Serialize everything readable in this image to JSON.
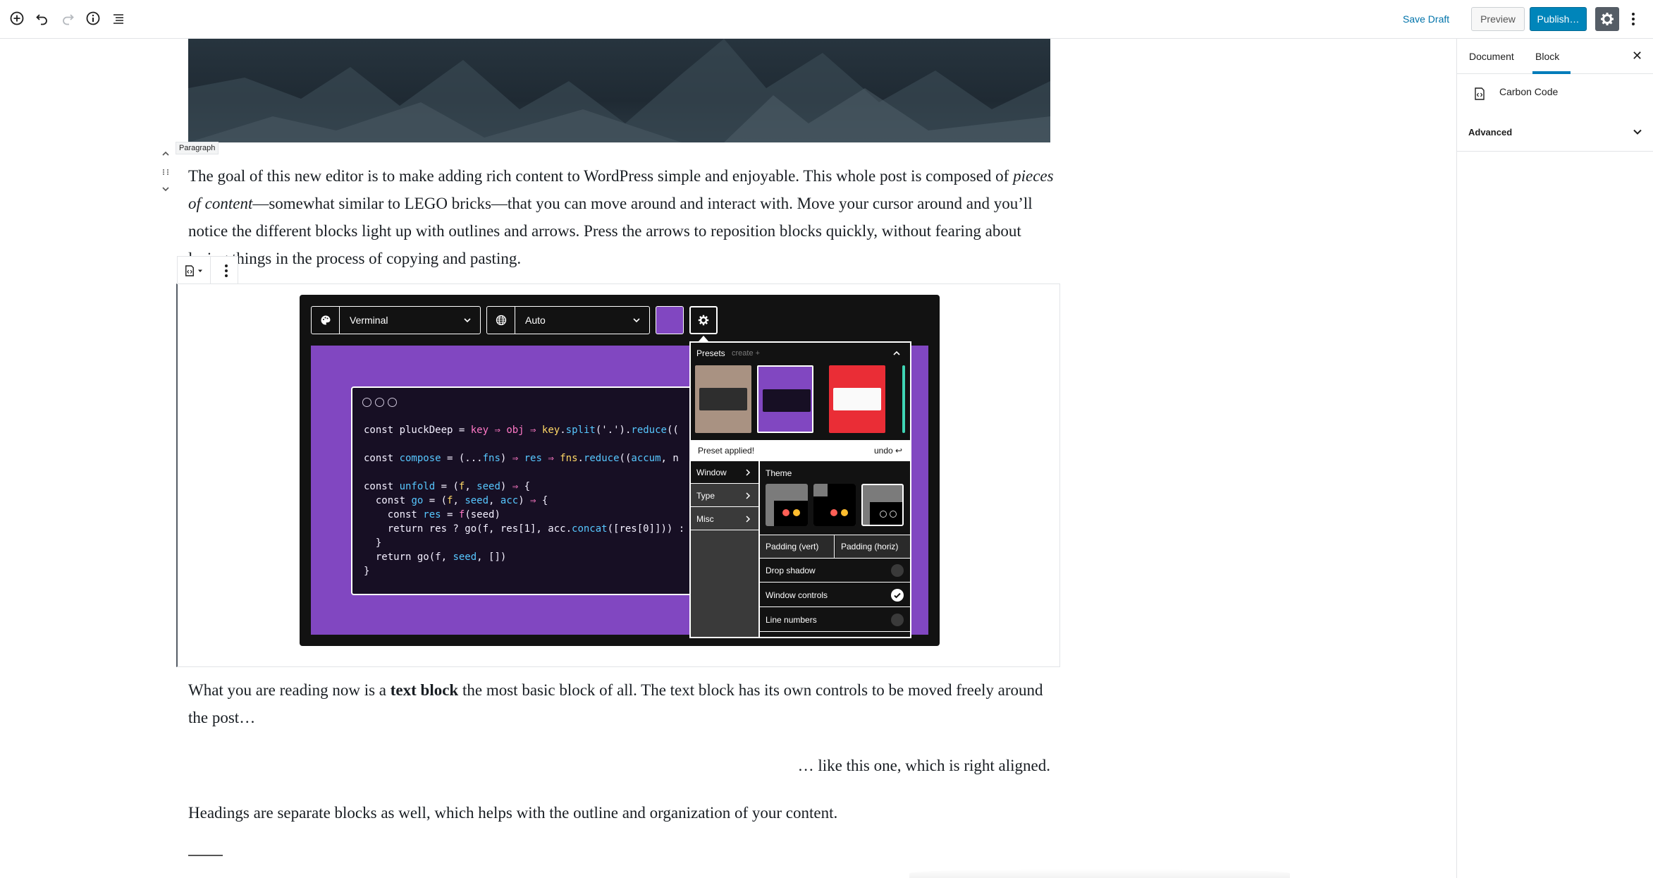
{
  "toolbar": {
    "save_draft": "Save Draft",
    "preview": "Preview",
    "publish": "Publish…"
  },
  "sidebar": {
    "tabs": [
      {
        "label": "Document"
      },
      {
        "label": "Block",
        "active": true
      }
    ],
    "block_card_title": "Carbon Code",
    "advanced_label": "Advanced"
  },
  "editor": {
    "paragraph_label": "Paragraph",
    "para1": {
      "part1": "The goal of this new editor is to make adding rich content to WordPress simple and enjoyable. This whole post is composed of ",
      "italic": "pieces of content",
      "part2": "—somewhat similar to LEGO bricks—that you can move around and interact with. Move your cursor around and you’ll notice the different blocks light up with outlines and arrows. Press the arrows to reposition blocks quickly, without fearing about losing things in the process of copying and pasting."
    },
    "para2": {
      "part1": "What you are reading now is a ",
      "bold": "text block",
      "part2": " the most basic block of all. The text block has its own controls to be moved freely around the post…"
    },
    "para3": "… like this one, which is right aligned.",
    "para4": "Headings are separate blocks as well, which helps with the outline and organization of your content."
  },
  "carbon": {
    "theme_select": "Verminal",
    "language_select": "Auto",
    "background_color": "#8147c1",
    "code_lines": [
      "const pluckDeep = key ⇒ obj ⇒ key.split('.').reduce((",
      "",
      "const compose = (...fns) ⇒ res ⇒ fns.reduce((accum, n",
      "",
      "const unfold = (f, seed) ⇒ {",
      "  const go = (f, seed, acc) ⇒ {",
      "    const res = f(seed)",
      "    return res ? go(f, res[1], acc.concat([res[0]])) :",
      "  }",
      "  return go(f, seed, [])",
      "}"
    ],
    "panel": {
      "presets_title": "Presets",
      "presets_create": "create +",
      "preset_applied": "Preset applied!",
      "undo": "undo ↩",
      "menu": [
        "Window",
        "Type",
        "Misc"
      ],
      "theme_label": "Theme",
      "padding_vert": "Padding (vert)",
      "padding_horiz": "Padding (horiz)",
      "toggles": [
        {
          "label": "Drop shadow",
          "on": false
        },
        {
          "label": "Window controls",
          "on": true
        },
        {
          "label": "Line numbers",
          "on": false
        }
      ]
    }
  }
}
